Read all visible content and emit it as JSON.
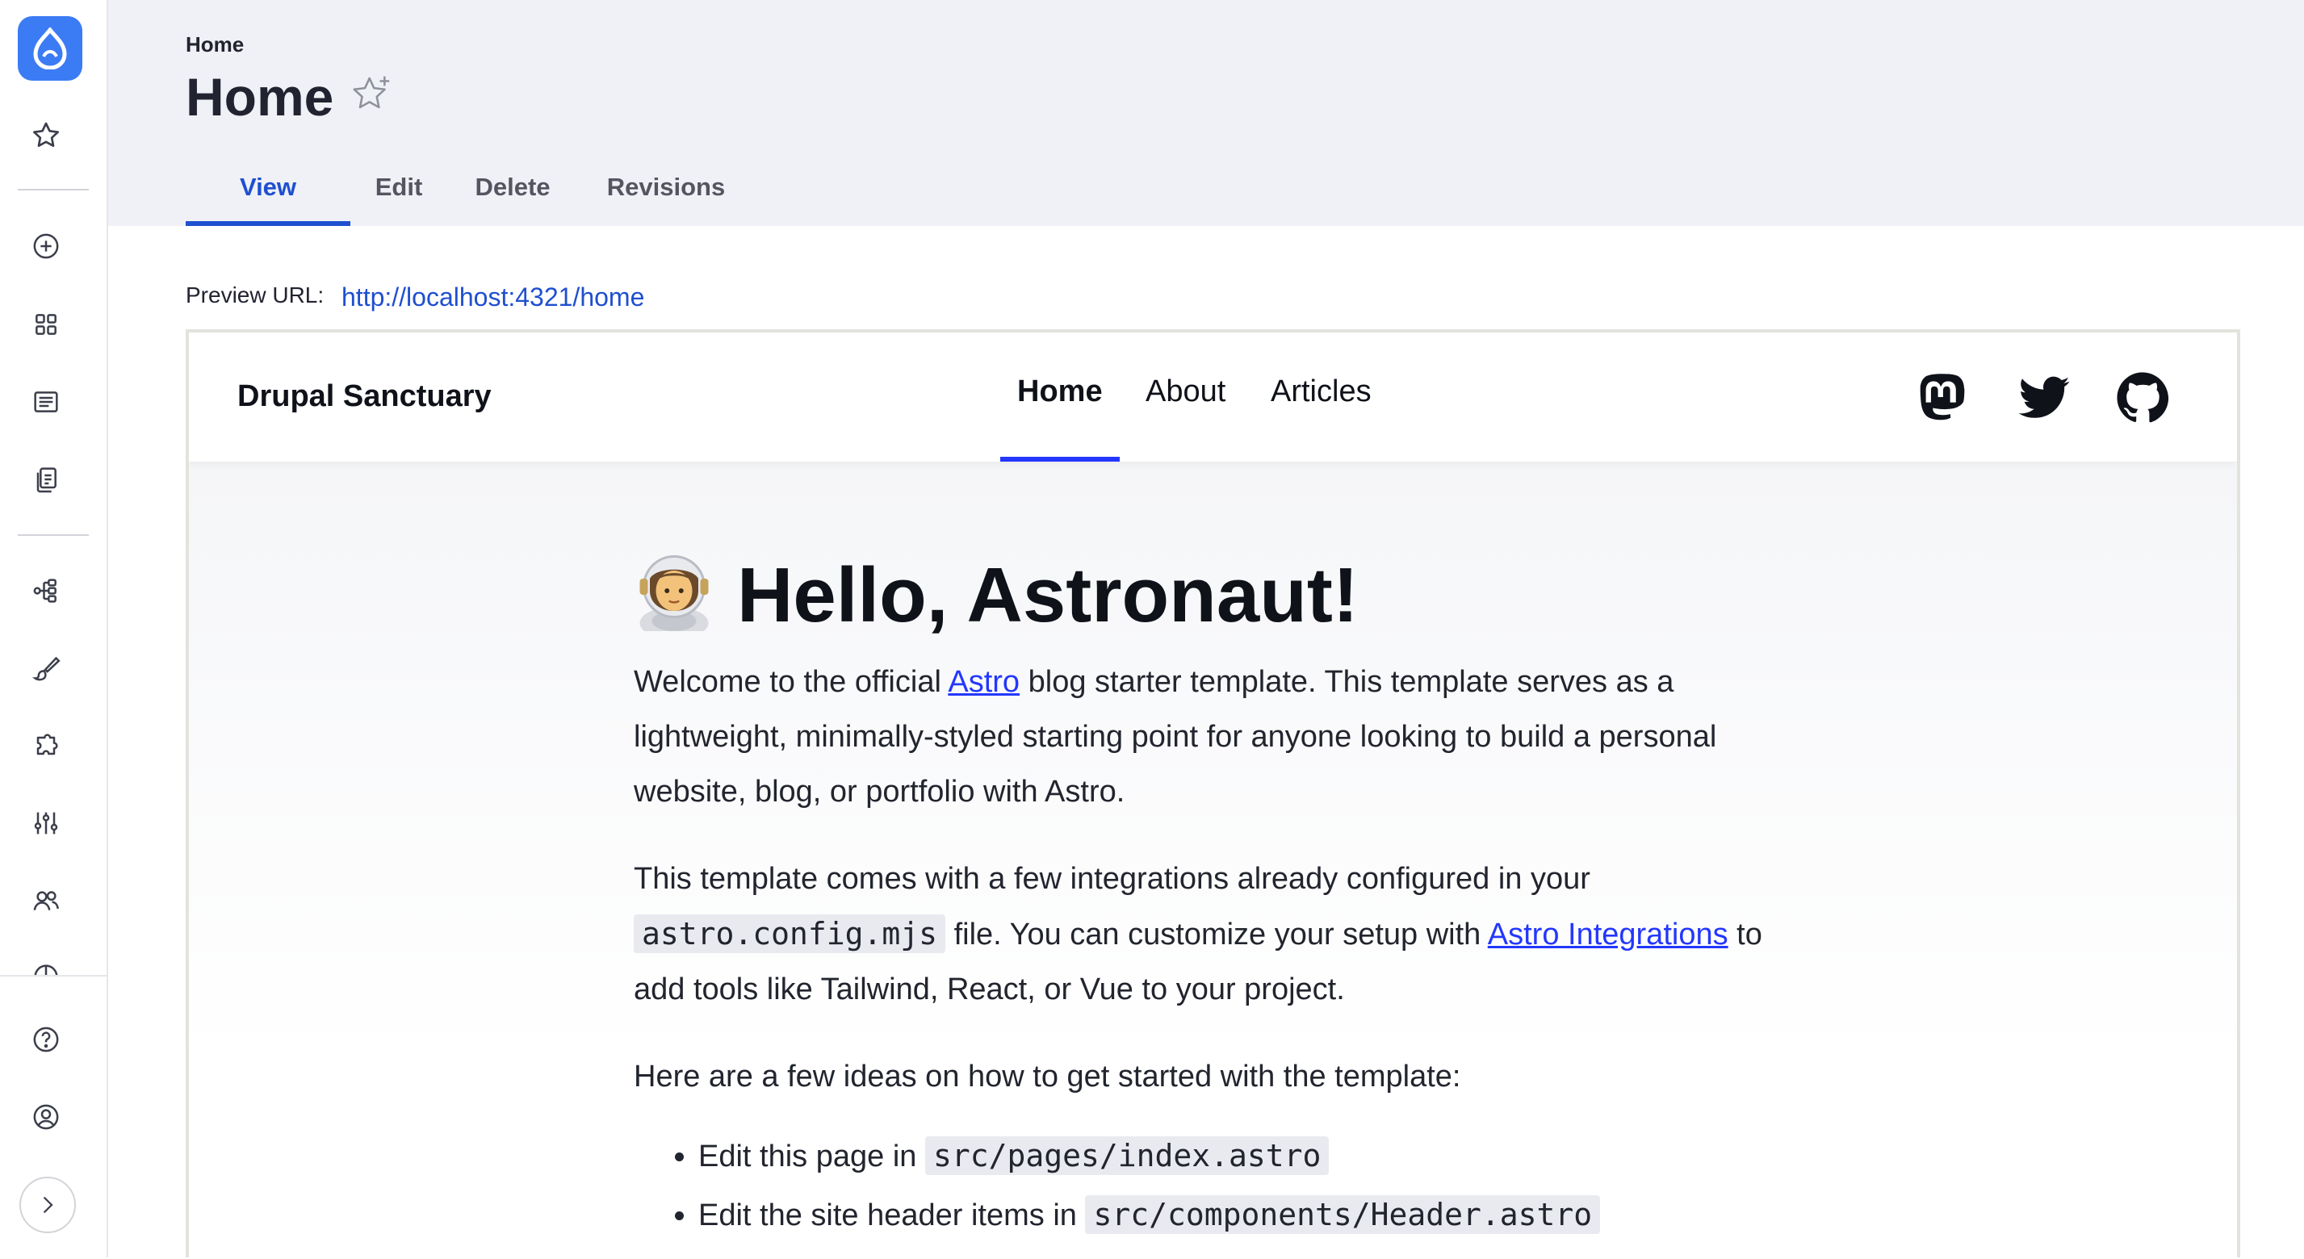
{
  "toolbar": {
    "icons": [
      "drupal-logo-icon",
      "star-icon",
      "plus-circle-icon",
      "grid-icon",
      "list-icon",
      "documents-icon",
      "structure-icon",
      "brush-icon",
      "puzzle-icon",
      "sliders-icon",
      "users-icon",
      "reports-icon",
      "help-icon",
      "user-icon",
      "chevron-right-icon"
    ],
    "accent": "#3b7cf5"
  },
  "header": {
    "breadcrumb": "Home",
    "title": "Home",
    "tabs": [
      {
        "label": "View",
        "active": true
      },
      {
        "label": "Edit"
      },
      {
        "label": "Delete"
      },
      {
        "label": "Revisions"
      }
    ],
    "active_color": "#1f4fd0"
  },
  "preview": {
    "label": "Preview URL:",
    "url": "http://localhost:4321/home"
  },
  "site": {
    "brand": "Drupal Sanctuary",
    "nav": [
      "Home",
      "About",
      "Articles"
    ],
    "social_icons": [
      "mastodon-icon",
      "twitter-icon",
      "github-icon"
    ],
    "accent": "#2337ff",
    "hero": "Hello, Astronaut!",
    "p1": {
      "before": "Welcome to the official ",
      "link": "Astro",
      "after": " blog starter template. This template serves as a lightweight, minimally-styled starting point for anyone looking to build a personal website, blog, or portfolio with Astro."
    },
    "p2": {
      "before": "This template comes with a few integrations already configured in your ",
      "code": "astro.config.mjs",
      "middle": " file. You can customize your setup with ",
      "link": "Astro Integrations",
      "after": " to add tools like Tailwind, React, or Vue to your project."
    },
    "p3": "Here are a few ideas on how to get started with the template:",
    "ideas": [
      {
        "text": "Edit this page in ",
        "code": "src/pages/index.astro"
      },
      {
        "text": "Edit the site header items in ",
        "code": "src/components/Header.astro"
      }
    ]
  }
}
